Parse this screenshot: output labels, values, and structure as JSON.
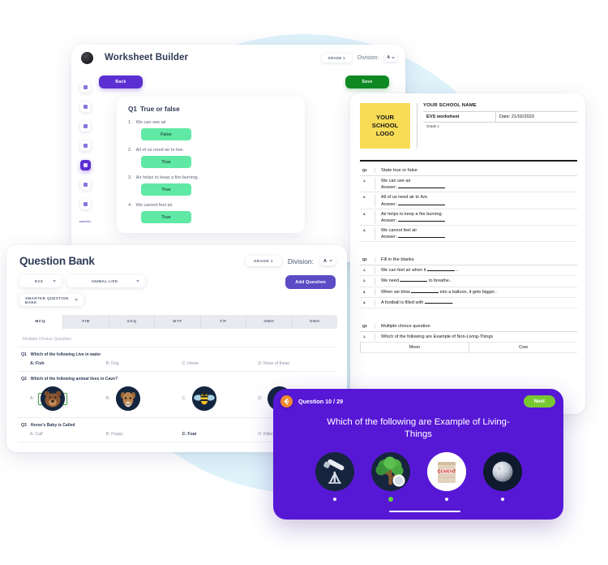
{
  "worksheet_builder": {
    "title": "Worksheet Builder",
    "avatar": "user-avatar",
    "grade_pill": "GRADE 1",
    "division_label": "Division:",
    "division_value": "A",
    "back_button": "Back",
    "save_button": "Save",
    "rail_label": "smartkr",
    "rail_items": [
      {
        "name": "dashboard-icon"
      },
      {
        "name": "book-icon"
      },
      {
        "name": "calendar-icon"
      },
      {
        "name": "chart-icon"
      },
      {
        "name": "worksheet-icon"
      },
      {
        "name": "report-icon"
      },
      {
        "name": "settings-icon"
      }
    ],
    "question_card": {
      "number": "Q1",
      "title": "True or false",
      "items": [
        {
          "index": "1.",
          "text": "We can see air",
          "answer": "False"
        },
        {
          "index": "2.",
          "text": "All of us need air to live.",
          "answer": "True"
        },
        {
          "index": "3.",
          "text": "Air helps to keep a fire burning.",
          "answer": "True"
        },
        {
          "index": "4.",
          "text": "We cannot feel air",
          "answer": "True"
        }
      ]
    }
  },
  "document": {
    "logo_text": "YOUR\nSCHOOL\nLOGO",
    "logo_line1": "YOUR",
    "logo_line2": "SCHOOL",
    "logo_line3": "LOGO",
    "school_name": "YOUR SCHOOL NAME",
    "worksheet_name": "EVS worksheet",
    "date": "Date: 21/02/2023",
    "grade": "Grade 1",
    "sections": [
      {
        "label": "Q1",
        "title": "State true or false",
        "rows": [
          {
            "num": "1.",
            "text": "We can see air",
            "answer_label": "Answer:"
          },
          {
            "num": "2.",
            "text": "All of us need air to live.",
            "answer_label": "Answer:"
          },
          {
            "num": "3.",
            "text": "Air helps to keep a fire burning.",
            "answer_label": "Answer:"
          },
          {
            "num": "4.",
            "text": "We cannot feel air",
            "answer_label": "Answer:"
          }
        ]
      },
      {
        "label": "Q2",
        "title": "Fill in the blanks",
        "rows": [
          {
            "num": "1.",
            "pre": "We can feel air when it",
            "post": ".."
          },
          {
            "num": "2.",
            "pre": "We need",
            "post": "to breathe.."
          },
          {
            "num": "3.",
            "pre": "When we blow",
            "post": "into a balloon, it gets bigger.."
          },
          {
            "num": "4.",
            "pre": "A football is filled with",
            "post": "."
          }
        ]
      },
      {
        "label": "Q3",
        "title": "Multiple choice question",
        "mcq_prompt_num": "1.",
        "mcq_prompt": "Which of the following are Example of Non-Living-Things",
        "options": [
          "Moon",
          "Cow"
        ]
      }
    ]
  },
  "question_bank": {
    "title": "Question Bank",
    "grade_pill": "GRADE 1",
    "division_label": "Division:",
    "division_value": "A",
    "filters": {
      "subject": "EVS",
      "topic": "ANIMAL LIFE",
      "bank": "SMARTKR QUESTION BANK"
    },
    "add_question_button": "Add Question",
    "tabs": [
      {
        "label": "MCQ",
        "active": true
      },
      {
        "label": "FIB",
        "active": false
      },
      {
        "label": "SAQ",
        "active": false
      },
      {
        "label": "MTF",
        "active": false
      },
      {
        "label": "T/F",
        "active": false
      },
      {
        "label": "OMO",
        "active": false
      },
      {
        "label": "OWA",
        "active": false
      }
    ],
    "list_subtitle": "Multiple Choice Question",
    "questions": [
      {
        "number": "Q1",
        "text": "Which of the following Live in water",
        "type": "text",
        "options": [
          {
            "label": "A: Fish",
            "correct": true
          },
          {
            "label": "B: Dog",
            "correct": false
          },
          {
            "label": "C: Horse",
            "correct": false
          },
          {
            "label": "D: None of these",
            "correct": false
          }
        ]
      },
      {
        "number": "Q2",
        "text": "Which of the following animal lives in Cave?",
        "type": "image",
        "options": [
          {
            "label": "A:",
            "icon": "bear-icon",
            "correct": true
          },
          {
            "label": "B:",
            "icon": "deer-icon",
            "correct": false
          },
          {
            "label": "C:",
            "icon": "bee-icon",
            "correct": false
          },
          {
            "label": "D:",
            "icon": "bird-icon",
            "correct": false
          }
        ]
      },
      {
        "number": "Q3",
        "text": "Horse's Baby is Called",
        "type": "text",
        "options": [
          {
            "label": "A: Calf",
            "correct": false
          },
          {
            "label": "B: Puppy",
            "correct": false
          },
          {
            "label": "C: Foal",
            "correct": true
          },
          {
            "label": "D: Kitten",
            "correct": false
          }
        ]
      }
    ]
  },
  "quiz": {
    "back_icon": "back-arrow-icon",
    "question_counter": "Question 10 / 29",
    "next_button": "Next",
    "question": "Which of the following are Example of Living-Things",
    "options": [
      {
        "icon": "telescope-icon",
        "selected": false
      },
      {
        "icon": "tree-icon",
        "selected": true
      },
      {
        "icon": "cement-bag-icon",
        "selected": false,
        "light": true
      },
      {
        "icon": "moon-icon",
        "selected": false
      }
    ],
    "cement_label": "CEMENT"
  },
  "colors": {
    "brand_purple": "#5b2fd1",
    "quiz_purple": "#5718d6",
    "accent_green": "#5fe9a4",
    "save_green": "#0f8a22",
    "next_green": "#78c832",
    "logo_yellow": "#f8dc55",
    "bg_blue": "#dff3fb",
    "orange": "#f08a2e"
  }
}
